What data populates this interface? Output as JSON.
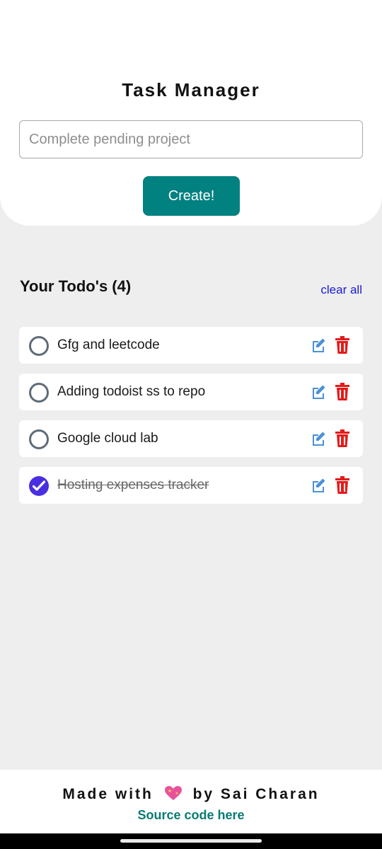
{
  "app": {
    "title": "Task Manager"
  },
  "form": {
    "placeholder": "Complete pending project",
    "create_label": "Create!"
  },
  "list": {
    "title": "Your Todo's (4)",
    "clear_label": "clear all",
    "items": [
      {
        "text": "Gfg and leetcode",
        "done": false
      },
      {
        "text": "Adding todoist ss to repo",
        "done": false
      },
      {
        "text": "Google cloud lab",
        "done": false
      },
      {
        "text": "Hosting expenses tracker",
        "done": true
      }
    ]
  },
  "footer": {
    "made_prefix": "Made with",
    "made_suffix": "by Sai Charan",
    "heart_icon": "sparkling-heart-icon",
    "source_label": "Source code here"
  },
  "colors": {
    "accent": "#018180",
    "checked": "#4a2fe0",
    "edit_icon": "#4a90d9",
    "delete_icon": "#e31b1b",
    "link": "#1a1ad6"
  }
}
